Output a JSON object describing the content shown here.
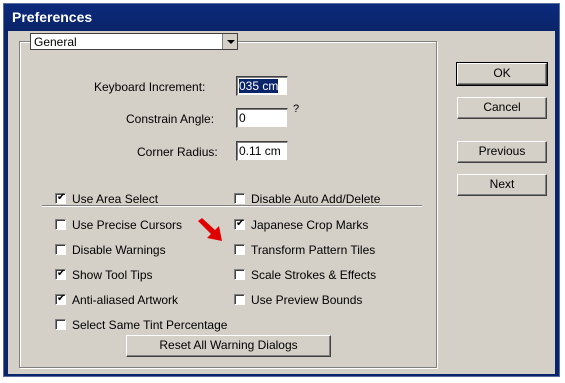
{
  "window": {
    "title": "Preferences"
  },
  "section_select": {
    "value": "General"
  },
  "fields": {
    "keyboard_increment": {
      "label": "Keyboard Increment:",
      "value": "035 cm"
    },
    "constrain_angle": {
      "label": "Constrain Angle:",
      "value": "0",
      "suffix": "?"
    },
    "corner_radius": {
      "label": "Corner Radius:",
      "value": "0.11 cm"
    }
  },
  "checkboxes": {
    "use_area_select": {
      "label": "Use Area Select",
      "checked": true
    },
    "use_precise_cursors": {
      "label": "Use Precise Cursors",
      "checked": false
    },
    "disable_warnings": {
      "label": "Disable Warnings",
      "checked": false
    },
    "show_tool_tips": {
      "label": "Show Tool Tips",
      "checked": true
    },
    "anti_aliased_artwork": {
      "label": "Anti-aliased Artwork",
      "checked": true
    },
    "select_same_tint": {
      "label": "Select Same Tint Percentage",
      "checked": false
    },
    "disable_auto_add_delete": {
      "label": "Disable Auto Add/Delete",
      "checked": false
    },
    "japanese_crop_marks": {
      "label": "Japanese Crop Marks",
      "checked": true
    },
    "transform_pattern_tiles": {
      "label": "Transform Pattern Tiles",
      "checked": false
    },
    "scale_strokes_effects": {
      "label": "Scale Strokes & Effects",
      "checked": false
    },
    "use_preview_bounds": {
      "label": "Use Preview Bounds",
      "checked": false
    }
  },
  "buttons": {
    "ok": "OK",
    "cancel": "Cancel",
    "previous": "Previous",
    "next": "Next",
    "reset_warnings": "Reset All Warning Dialogs"
  },
  "colors": {
    "titlebar": "#0a246a",
    "dialog": "#d4d0c8",
    "annotation_arrow": "#e00000"
  }
}
